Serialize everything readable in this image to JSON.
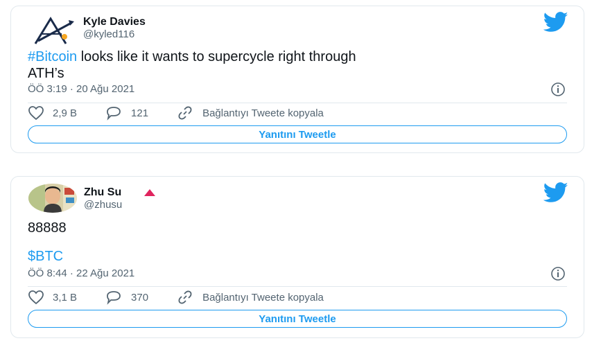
{
  "tweets": [
    {
      "author_name": "Kyle Davies",
      "author_handle": "@kyled116",
      "hashtag": "#Bitcoin",
      "text_rest": " looks like it wants to supercycle right through",
      "text_line2": "ATH’s",
      "timestamp": "ÖÖ 3:19 · 20 Ağu 2021",
      "likes": "2,9 B",
      "replies": "121",
      "copy_link": "Bağlantıyı Tweete kopyala",
      "reply_button": "Yanıtını Tweetle",
      "avatar_icon": "logo-triangle-icon"
    },
    {
      "author_name": "Zhu Su",
      "author_handle": "@zhusu",
      "text_line1": "88888",
      "cashtag": "$BTC",
      "timestamp": "ÖÖ 8:44 · 22 Ağu 2021",
      "likes": "3,1 B",
      "replies": "370",
      "copy_link": "Bağlantıyı Tweete kopyala",
      "reply_button": "Yanıtını Tweetle",
      "badge_icon": "red-triangle-icon"
    }
  ],
  "colors": {
    "accent": "#1d9bf0",
    "muted": "#536471",
    "border": "#e1e8ed",
    "badge": "#e0245e"
  }
}
